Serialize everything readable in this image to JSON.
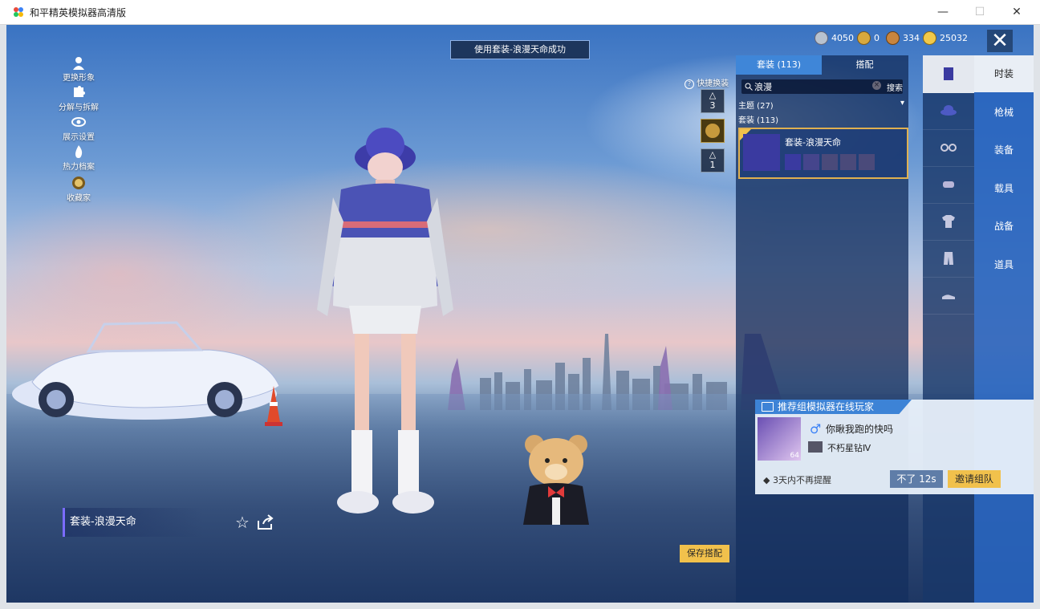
{
  "window": {
    "title": "和平精英模拟器高清版"
  },
  "toast": "使用套装-浪漫天命成功",
  "currencies": [
    {
      "icon": "silver-coin-icon",
      "value": "4050",
      "color": "#b8c2cf"
    },
    {
      "icon": "gold-medal-icon",
      "value": "0",
      "color": "#d8a93e"
    },
    {
      "icon": "bronze-coin-icon",
      "value": "334",
      "color": "#c8853f"
    },
    {
      "icon": "gold-coin-icon",
      "value": "25032",
      "color": "#f1c94a"
    }
  ],
  "left_menu": [
    {
      "label": "更换形象",
      "icon": "person-icon"
    },
    {
      "label": "分解与拆解",
      "icon": "puzzle-icon"
    },
    {
      "label": "展示设置",
      "icon": "eye-icon"
    },
    {
      "label": "热力档案",
      "icon": "flame-icon"
    },
    {
      "label": "收藏家",
      "icon": "trophy-icon"
    }
  ],
  "quick_swap": {
    "label": "快捷换装",
    "slots": [
      "3",
      "",
      "1"
    ]
  },
  "panel": {
    "tabs": [
      "套装 (113)",
      "搭配"
    ],
    "search": {
      "value": "浪漫",
      "button": "搜索"
    },
    "theme_label": "主题 (27)",
    "suits_label": "套装 (113)",
    "card_title": "套装-浪漫天命"
  },
  "category_tabs": [
    "时装",
    "枪械",
    "装备",
    "载具",
    "战备",
    "道具"
  ],
  "outfit_name": "套装-浪漫天命",
  "save_button": "保存搭配",
  "recommend": {
    "header": "推荐组模拟器在线玩家",
    "player_name": "你瞅我跑的快吗",
    "rank": "不朽星钻Ⅳ",
    "level": "64",
    "dont_remind": "3天内不再提醒",
    "decline_button": "不了 12s",
    "invite_button": "邀请组队"
  }
}
